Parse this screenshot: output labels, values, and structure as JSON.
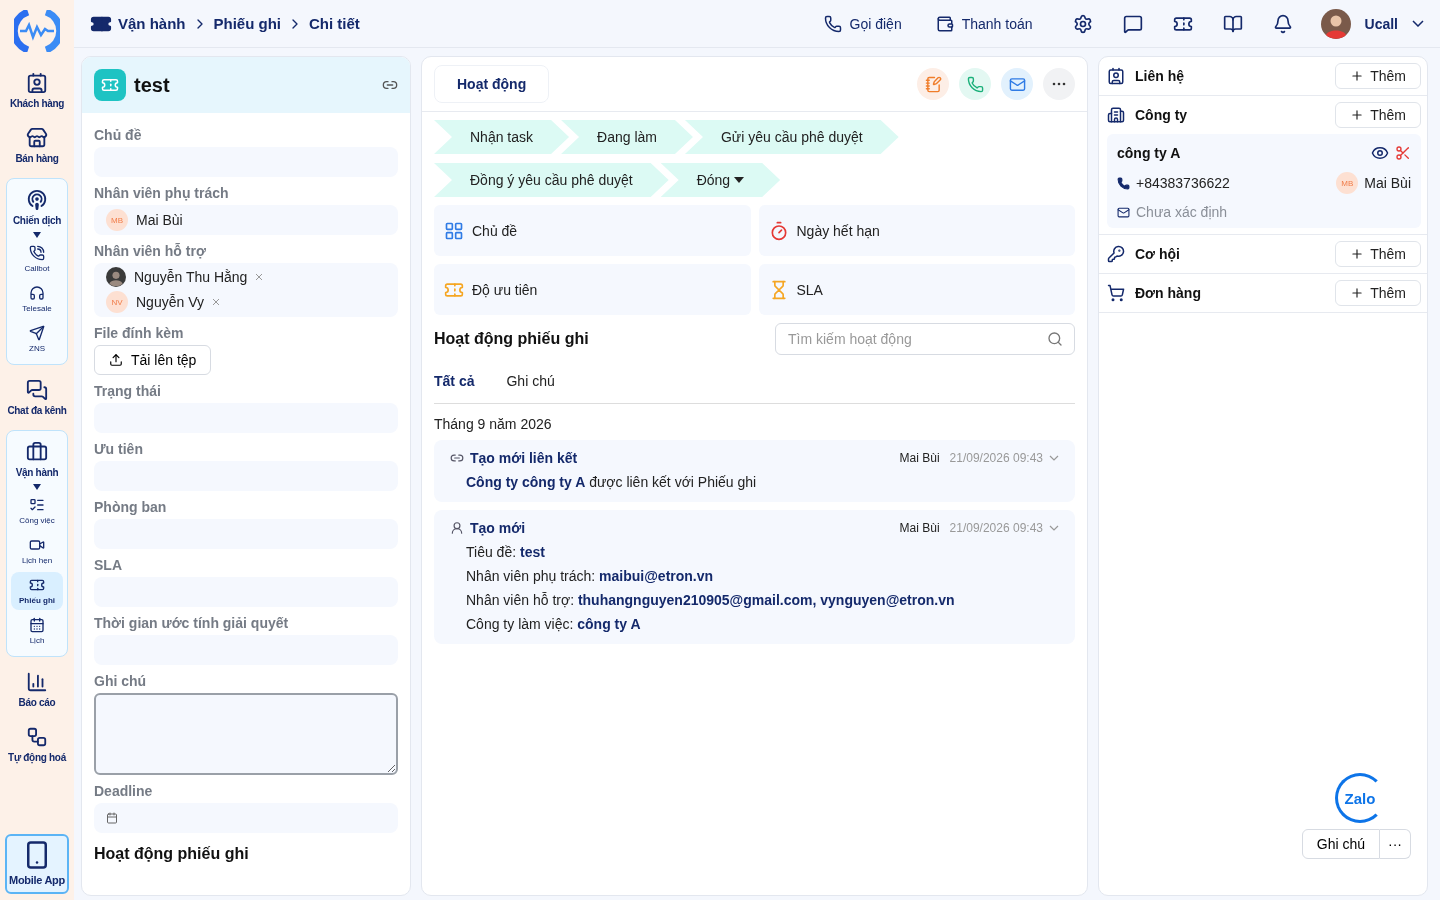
{
  "sidebar": {
    "items": [
      {
        "label": "Khách hàng",
        "kind": "item"
      },
      {
        "label": "Bán hàng",
        "kind": "item"
      },
      {
        "label": "Chiến dịch",
        "kind": "group",
        "expanded": true,
        "children": [
          {
            "label": "Callbot",
            "selected": false
          },
          {
            "label": "Telesale",
            "selected": false
          },
          {
            "label": "ZNS",
            "selected": false
          }
        ]
      },
      {
        "label": "Chat đa kênh",
        "kind": "item"
      },
      {
        "label": "Vận hành",
        "kind": "group",
        "expanded": true,
        "children": [
          {
            "label": "Công việc",
            "selected": false
          },
          {
            "label": "Lịch hẹn",
            "selected": false
          },
          {
            "label": "Phiếu ghi",
            "selected": true
          },
          {
            "label": "Lịch",
            "selected": false
          }
        ]
      },
      {
        "label": "Báo cáo",
        "kind": "item"
      },
      {
        "label": "Tự động hoá",
        "kind": "item"
      },
      {
        "label": "Mobile App",
        "kind": "app"
      }
    ]
  },
  "header": {
    "breadcrumb": [
      "Vận hành",
      "Phiếu ghi",
      "Chi tiết"
    ],
    "actions": [
      "Gọi điện",
      "Thanh toán"
    ],
    "user": {
      "name": "Ucall"
    }
  },
  "ticket": {
    "title": "test",
    "fields": [
      {
        "label": "Chủ đề",
        "kind": "empty"
      },
      {
        "label": "Nhân viên phụ trách",
        "kind": "users",
        "users": [
          {
            "name": "Mai Bùi",
            "initials": "MB",
            "removable": false
          }
        ]
      },
      {
        "label": "Nhân viên hỗ trợ",
        "kind": "users",
        "users": [
          {
            "name": "Nguyễn Thu Hằng",
            "removable": true
          },
          {
            "name": "Nguyễn Vy",
            "initials": "NV",
            "removable": true
          }
        ]
      },
      {
        "label": "File đính kèm",
        "kind": "upload",
        "button": "Tải lên tệp"
      },
      {
        "label": "Trạng thái",
        "kind": "empty"
      },
      {
        "label": "Ưu tiên",
        "kind": "empty"
      },
      {
        "label": "Phòng ban",
        "kind": "empty"
      },
      {
        "label": "SLA",
        "kind": "empty"
      },
      {
        "label": "Thời gian ước tính giải quyết",
        "kind": "empty"
      },
      {
        "label": "Ghi chú",
        "kind": "textarea"
      },
      {
        "label": "Deadline",
        "kind": "date"
      }
    ],
    "footer_title": "Hoạt động phiếu ghi"
  },
  "activity": {
    "tab": "Hoạt động",
    "stages": [
      {
        "label": "Nhận task",
        "kind": "step"
      },
      {
        "label": "Đang làm",
        "kind": "step"
      },
      {
        "label": "Gửi yêu cầu phê duyệt",
        "kind": "step"
      },
      {
        "label": "Đồng ý yêu cầu phê duyệt",
        "kind": "step"
      },
      {
        "label": "Đóng",
        "kind": "dropdown"
      }
    ],
    "info": [
      "Chủ đề",
      "Ngày hết hạn",
      "Độ ưu tiên",
      "SLA"
    ],
    "title": "Hoạt động phiếu ghi",
    "search": {
      "placeholder": "Tìm kiếm hoạt động"
    },
    "tabs": [
      {
        "label": "Tất cả",
        "selected": true
      },
      {
        "label": "Ghi chú",
        "selected": false
      }
    ],
    "month": "Tháng 9 năm 2026",
    "entries": [
      {
        "title": "Tạo mới liên kết",
        "author": "Mai Bùi",
        "time": "21/09/2026 09:43",
        "lines": [
          "**Công ty công ty A** được liên kết với Phiếu ghi"
        ]
      },
      {
        "title": "Tạo mới",
        "author": "Mai Bùi",
        "time": "21/09/2026 09:43",
        "lines": [
          "Tiêu đề: **test**",
          "Nhân viên phụ trách: **maibui@etron.vn**",
          "Nhân viên hỗ trợ: **thuhangnguyen210905@gmail.com, vynguyen@etron.vn**",
          "Công ty làm việc: **công ty A**"
        ]
      }
    ]
  },
  "related": {
    "sections": [
      {
        "title": "Liên hệ",
        "button": "Thêm"
      },
      {
        "title": "Công ty",
        "button": "Thêm",
        "card": {
          "name": "công ty A",
          "phone": "+84383736622",
          "owner": "Mai Bùi",
          "owner_initials": "MB",
          "email": "Chưa xác định"
        }
      },
      {
        "title": "Cơ hội",
        "button": "Thêm"
      },
      {
        "title": "Đơn hàng",
        "button": "Thêm"
      }
    ],
    "note_button": "Ghi chú",
    "more": "···",
    "zalo": "Zalo"
  }
}
